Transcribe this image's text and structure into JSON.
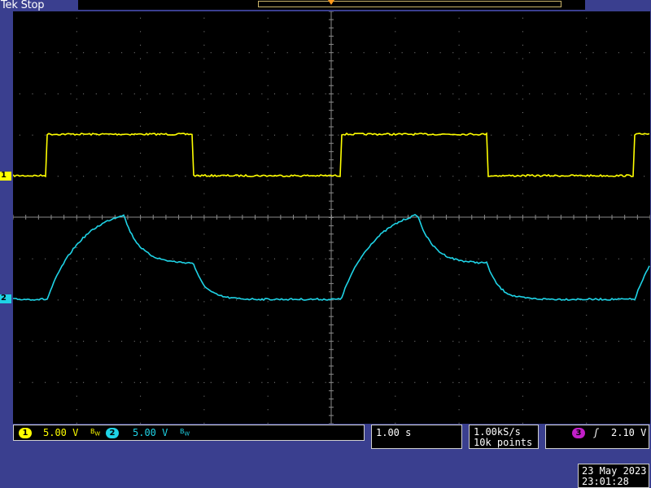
{
  "header": {
    "brand_status": "Tek Stop"
  },
  "channels": [
    {
      "number": "1",
      "scale": "5.00 V",
      "color": "#ffff00"
    },
    {
      "number": "2",
      "scale": "5.00 V",
      "color": "#1fd3e6"
    }
  ],
  "bandwidth_icon": "bandwidth-limit-icon",
  "timebase": {
    "scale": "1.00 s"
  },
  "acquisition": {
    "sample_rate": "1.00kS/s",
    "record_length": "10k points"
  },
  "trigger": {
    "source": "3",
    "slope_icon": "rising-edge-icon",
    "slope_glyph": "ʃ",
    "level": "2.10 V",
    "color": "#c21fc9"
  },
  "datetime": {
    "date": "23 May 2023",
    "time": "23:01:28"
  },
  "colors": {
    "background": "#3a3f8f",
    "graticule": "#8a8a8a",
    "ch1": "#ffff00",
    "ch2": "#1fd3e6"
  }
}
